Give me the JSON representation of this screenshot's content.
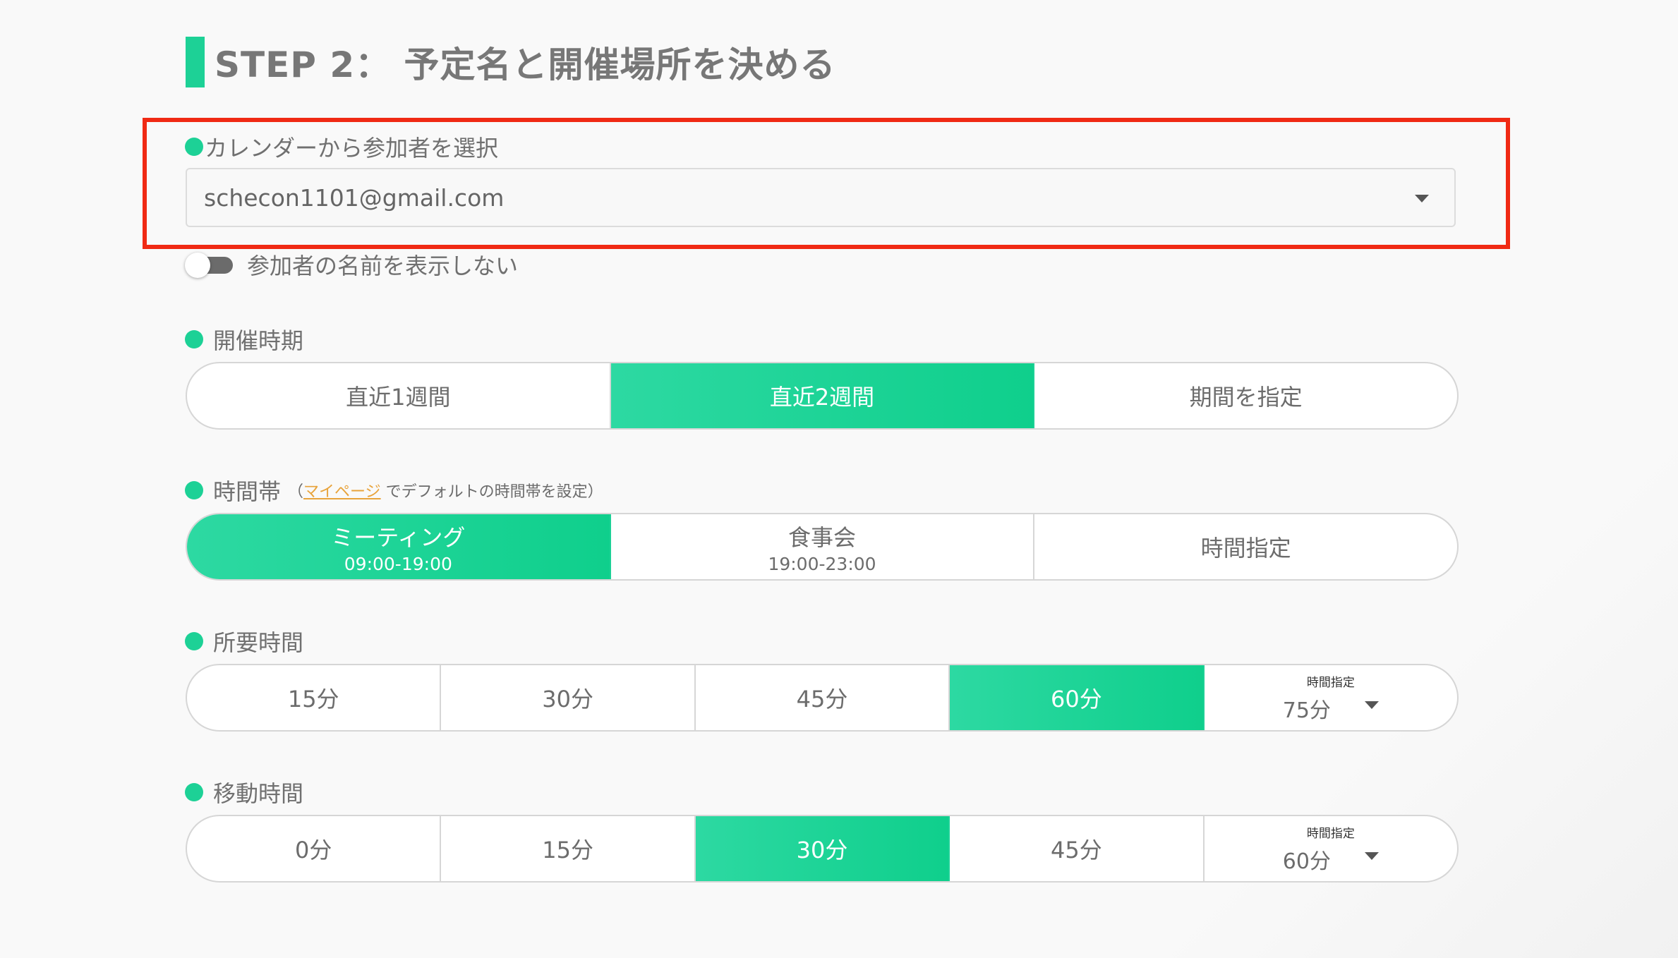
{
  "step": {
    "title": "STEP 2： 予定名と開催場所を決める"
  },
  "calendar": {
    "label": "カレンダーから参加者を選択",
    "selected": "schecon1101@gmail.com"
  },
  "hide_names": {
    "label": "参加者の名前を表示しない",
    "enabled": false
  },
  "period": {
    "label": "開催時期",
    "options": [
      "直近1週間",
      "直近2週間",
      "期間を指定"
    ],
    "selected": "直近2週間"
  },
  "timeslot": {
    "label": "時間帯",
    "note_open": "（",
    "note_link": "マイページ",
    "note_rest": " でデフォルトの時間帯を設定）",
    "options": [
      {
        "name": "ミーティング",
        "time": "09:00-19:00"
      },
      {
        "name": "食事会",
        "time": "19:00-23:00"
      },
      {
        "name": "時間指定",
        "time": ""
      }
    ],
    "selected": "ミーティング"
  },
  "duration": {
    "label": "所要時間",
    "options": [
      "15分",
      "30分",
      "45分",
      "60分"
    ],
    "selected": "60分",
    "custom": {
      "caption": "時間指定",
      "value": "75分"
    }
  },
  "travel": {
    "label": "移動時間",
    "options": [
      "0分",
      "15分",
      "30分",
      "45分"
    ],
    "selected": "30分",
    "custom": {
      "caption": "時間指定",
      "value": "60分"
    }
  },
  "colors": {
    "accent": "#1dd196",
    "highlight_border": "#f02a14",
    "link": "#e8a33b"
  }
}
